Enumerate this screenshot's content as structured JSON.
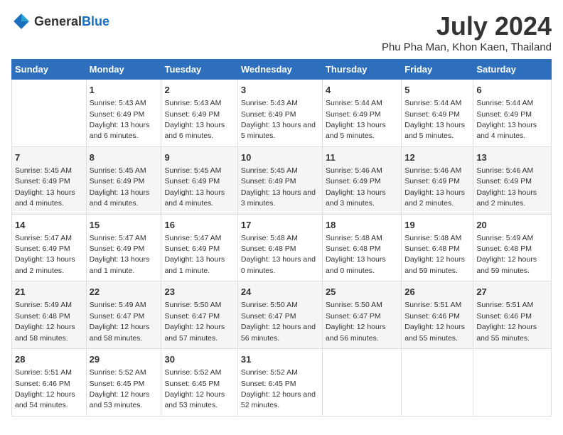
{
  "logo": {
    "general": "General",
    "blue": "Blue"
  },
  "header": {
    "title": "July 2024",
    "subtitle": "Phu Pha Man, Khon Kaen, Thailand"
  },
  "days": [
    "Sunday",
    "Monday",
    "Tuesday",
    "Wednesday",
    "Thursday",
    "Friday",
    "Saturday"
  ],
  "weeks": [
    [
      {
        "num": "",
        "sunrise": "",
        "sunset": "",
        "daylight": ""
      },
      {
        "num": "1",
        "sunrise": "Sunrise: 5:43 AM",
        "sunset": "Sunset: 6:49 PM",
        "daylight": "Daylight: 13 hours and 6 minutes."
      },
      {
        "num": "2",
        "sunrise": "Sunrise: 5:43 AM",
        "sunset": "Sunset: 6:49 PM",
        "daylight": "Daylight: 13 hours and 6 minutes."
      },
      {
        "num": "3",
        "sunrise": "Sunrise: 5:43 AM",
        "sunset": "Sunset: 6:49 PM",
        "daylight": "Daylight: 13 hours and 5 minutes."
      },
      {
        "num": "4",
        "sunrise": "Sunrise: 5:44 AM",
        "sunset": "Sunset: 6:49 PM",
        "daylight": "Daylight: 13 hours and 5 minutes."
      },
      {
        "num": "5",
        "sunrise": "Sunrise: 5:44 AM",
        "sunset": "Sunset: 6:49 PM",
        "daylight": "Daylight: 13 hours and 5 minutes."
      },
      {
        "num": "6",
        "sunrise": "Sunrise: 5:44 AM",
        "sunset": "Sunset: 6:49 PM",
        "daylight": "Daylight: 13 hours and 4 minutes."
      }
    ],
    [
      {
        "num": "7",
        "sunrise": "Sunrise: 5:45 AM",
        "sunset": "Sunset: 6:49 PM",
        "daylight": "Daylight: 13 hours and 4 minutes."
      },
      {
        "num": "8",
        "sunrise": "Sunrise: 5:45 AM",
        "sunset": "Sunset: 6:49 PM",
        "daylight": "Daylight: 13 hours and 4 minutes."
      },
      {
        "num": "9",
        "sunrise": "Sunrise: 5:45 AM",
        "sunset": "Sunset: 6:49 PM",
        "daylight": "Daylight: 13 hours and 4 minutes."
      },
      {
        "num": "10",
        "sunrise": "Sunrise: 5:45 AM",
        "sunset": "Sunset: 6:49 PM",
        "daylight": "Daylight: 13 hours and 3 minutes."
      },
      {
        "num": "11",
        "sunrise": "Sunrise: 5:46 AM",
        "sunset": "Sunset: 6:49 PM",
        "daylight": "Daylight: 13 hours and 3 minutes."
      },
      {
        "num": "12",
        "sunrise": "Sunrise: 5:46 AM",
        "sunset": "Sunset: 6:49 PM",
        "daylight": "Daylight: 13 hours and 2 minutes."
      },
      {
        "num": "13",
        "sunrise": "Sunrise: 5:46 AM",
        "sunset": "Sunset: 6:49 PM",
        "daylight": "Daylight: 13 hours and 2 minutes."
      }
    ],
    [
      {
        "num": "14",
        "sunrise": "Sunrise: 5:47 AM",
        "sunset": "Sunset: 6:49 PM",
        "daylight": "Daylight: 13 hours and 2 minutes."
      },
      {
        "num": "15",
        "sunrise": "Sunrise: 5:47 AM",
        "sunset": "Sunset: 6:49 PM",
        "daylight": "Daylight: 13 hours and 1 minute."
      },
      {
        "num": "16",
        "sunrise": "Sunrise: 5:47 AM",
        "sunset": "Sunset: 6:49 PM",
        "daylight": "Daylight: 13 hours and 1 minute."
      },
      {
        "num": "17",
        "sunrise": "Sunrise: 5:48 AM",
        "sunset": "Sunset: 6:48 PM",
        "daylight": "Daylight: 13 hours and 0 minutes."
      },
      {
        "num": "18",
        "sunrise": "Sunrise: 5:48 AM",
        "sunset": "Sunset: 6:48 PM",
        "daylight": "Daylight: 13 hours and 0 minutes."
      },
      {
        "num": "19",
        "sunrise": "Sunrise: 5:48 AM",
        "sunset": "Sunset: 6:48 PM",
        "daylight": "Daylight: 12 hours and 59 minutes."
      },
      {
        "num": "20",
        "sunrise": "Sunrise: 5:49 AM",
        "sunset": "Sunset: 6:48 PM",
        "daylight": "Daylight: 12 hours and 59 minutes."
      }
    ],
    [
      {
        "num": "21",
        "sunrise": "Sunrise: 5:49 AM",
        "sunset": "Sunset: 6:48 PM",
        "daylight": "Daylight: 12 hours and 58 minutes."
      },
      {
        "num": "22",
        "sunrise": "Sunrise: 5:49 AM",
        "sunset": "Sunset: 6:47 PM",
        "daylight": "Daylight: 12 hours and 58 minutes."
      },
      {
        "num": "23",
        "sunrise": "Sunrise: 5:50 AM",
        "sunset": "Sunset: 6:47 PM",
        "daylight": "Daylight: 12 hours and 57 minutes."
      },
      {
        "num": "24",
        "sunrise": "Sunrise: 5:50 AM",
        "sunset": "Sunset: 6:47 PM",
        "daylight": "Daylight: 12 hours and 56 minutes."
      },
      {
        "num": "25",
        "sunrise": "Sunrise: 5:50 AM",
        "sunset": "Sunset: 6:47 PM",
        "daylight": "Daylight: 12 hours and 56 minutes."
      },
      {
        "num": "26",
        "sunrise": "Sunrise: 5:51 AM",
        "sunset": "Sunset: 6:46 PM",
        "daylight": "Daylight: 12 hours and 55 minutes."
      },
      {
        "num": "27",
        "sunrise": "Sunrise: 5:51 AM",
        "sunset": "Sunset: 6:46 PM",
        "daylight": "Daylight: 12 hours and 55 minutes."
      }
    ],
    [
      {
        "num": "28",
        "sunrise": "Sunrise: 5:51 AM",
        "sunset": "Sunset: 6:46 PM",
        "daylight": "Daylight: 12 hours and 54 minutes."
      },
      {
        "num": "29",
        "sunrise": "Sunrise: 5:52 AM",
        "sunset": "Sunset: 6:45 PM",
        "daylight": "Daylight: 12 hours and 53 minutes."
      },
      {
        "num": "30",
        "sunrise": "Sunrise: 5:52 AM",
        "sunset": "Sunset: 6:45 PM",
        "daylight": "Daylight: 12 hours and 53 minutes."
      },
      {
        "num": "31",
        "sunrise": "Sunrise: 5:52 AM",
        "sunset": "Sunset: 6:45 PM",
        "daylight": "Daylight: 12 hours and 52 minutes."
      },
      {
        "num": "",
        "sunrise": "",
        "sunset": "",
        "daylight": ""
      },
      {
        "num": "",
        "sunrise": "",
        "sunset": "",
        "daylight": ""
      },
      {
        "num": "",
        "sunrise": "",
        "sunset": "",
        "daylight": ""
      }
    ]
  ]
}
